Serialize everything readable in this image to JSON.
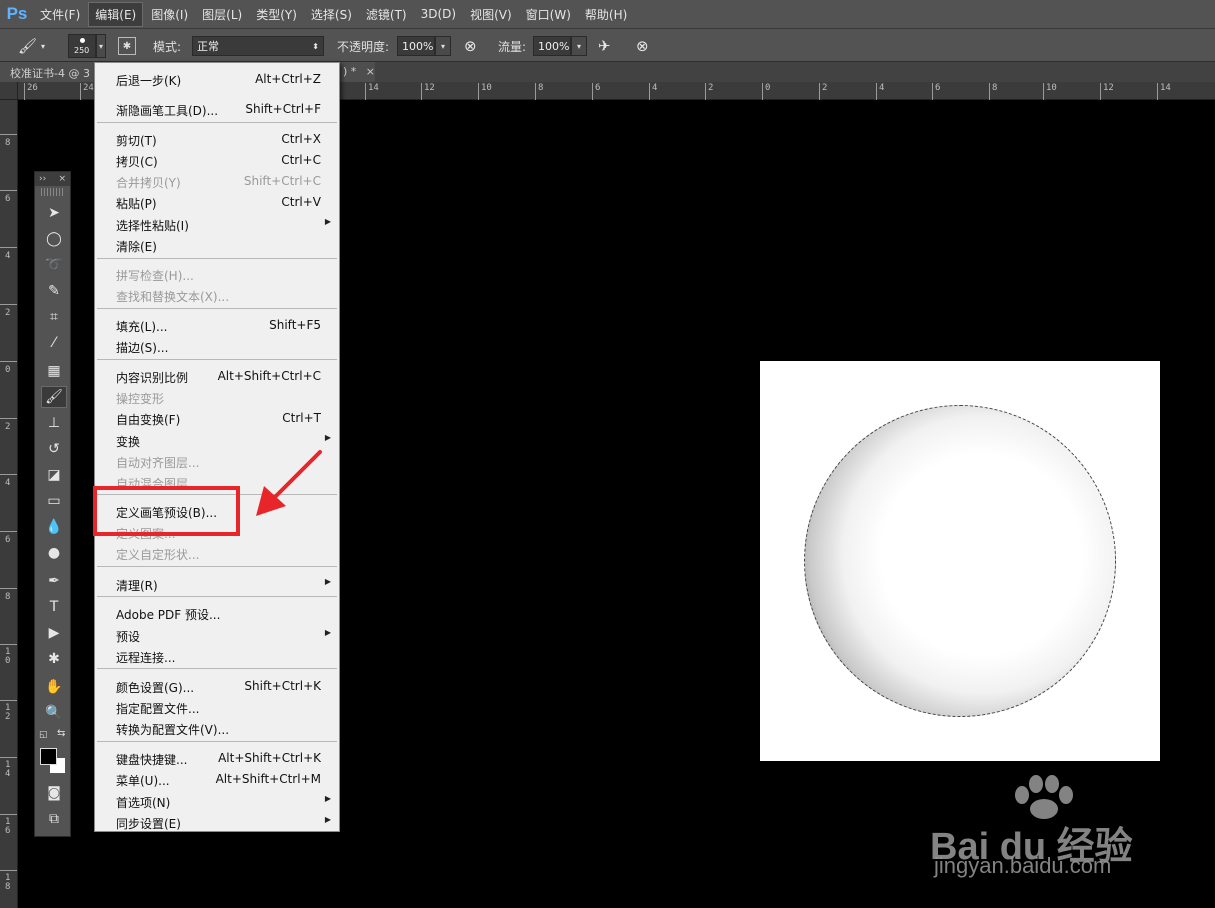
{
  "app": {
    "logo": "Ps",
    "menus": [
      "文件(F)",
      "编辑(E)",
      "图像(I)",
      "图层(L)",
      "类型(Y)",
      "选择(S)",
      "滤镜(T)",
      "3D(D)",
      "视图(V)",
      "窗口(W)",
      "帮助(H)"
    ],
    "active_menu": "编辑(E)"
  },
  "options_bar": {
    "brush_size": "250",
    "mode_label": "模式:",
    "mode_value": "正常",
    "opacity_label": "不透明度:",
    "opacity_value": "100%",
    "flow_label": "流量:",
    "flow_value": "100%"
  },
  "tabs": {
    "doc_tab_label": "校准证书-4 @ 3",
    "doc_tab_tail": ") *",
    "close_symbol": "×"
  },
  "ruler": {
    "top_ticks": [
      "26",
      "24",
      "14",
      "12",
      "10",
      "8",
      "6",
      "4",
      "2",
      "0",
      "2",
      "4",
      "6",
      "8",
      "10",
      "12",
      "14"
    ],
    "left_ticks": [
      "8",
      "6",
      "4",
      "2",
      "0",
      "2",
      "4",
      "6",
      "8",
      "1 0",
      "1 2",
      "1 4",
      "1 6",
      "1 8"
    ]
  },
  "toolbox": {
    "header_left": "››",
    "header_right": "×"
  },
  "edit_menu": {
    "items": [
      {
        "label": "后退一步(K)",
        "shortcut": "Alt+Ctrl+Z",
        "enabled": true
      },
      {
        "label": "渐隐画笔工具(D)...",
        "shortcut": "Shift+Ctrl+F",
        "enabled": true
      },
      {
        "label": "剪切(T)",
        "shortcut": "Ctrl+X",
        "enabled": true
      },
      {
        "label": "拷贝(C)",
        "shortcut": "Ctrl+C",
        "enabled": true
      },
      {
        "label": "合并拷贝(Y)",
        "shortcut": "Shift+Ctrl+C",
        "enabled": false
      },
      {
        "label": "粘贴(P)",
        "shortcut": "Ctrl+V",
        "enabled": true
      },
      {
        "label": "选择性粘贴(I)",
        "shortcut": "",
        "enabled": true,
        "submenu": true
      },
      {
        "label": "清除(E)",
        "shortcut": "",
        "enabled": true
      },
      {
        "label": "拼写检查(H)...",
        "shortcut": "",
        "enabled": false
      },
      {
        "label": "查找和替换文本(X)...",
        "shortcut": "",
        "enabled": false
      },
      {
        "label": "填充(L)...",
        "shortcut": "Shift+F5",
        "enabled": true
      },
      {
        "label": "描边(S)...",
        "shortcut": "",
        "enabled": true
      },
      {
        "label": "内容识别比例",
        "shortcut": "Alt+Shift+Ctrl+C",
        "enabled": true
      },
      {
        "label": "操控变形",
        "shortcut": "",
        "enabled": false
      },
      {
        "label": "自由变换(F)",
        "shortcut": "Ctrl+T",
        "enabled": true
      },
      {
        "label": "变换",
        "shortcut": "",
        "enabled": true,
        "submenu": true
      },
      {
        "label": "自动对齐图层...",
        "shortcut": "",
        "enabled": false
      },
      {
        "label": "自动混合图层...",
        "shortcut": "",
        "enabled": false
      },
      {
        "label": "定义画笔预设(B)...",
        "shortcut": "",
        "enabled": true
      },
      {
        "label": "定义图案...",
        "shortcut": "",
        "enabled": false
      },
      {
        "label": "定义自定形状...",
        "shortcut": "",
        "enabled": false
      },
      {
        "label": "清理(R)",
        "shortcut": "",
        "enabled": true,
        "submenu": true
      },
      {
        "label": "Adobe PDF 预设...",
        "shortcut": "",
        "enabled": true
      },
      {
        "label": "预设",
        "shortcut": "",
        "enabled": true,
        "submenu": true
      },
      {
        "label": "远程连接...",
        "shortcut": "",
        "enabled": true
      },
      {
        "label": "颜色设置(G)...",
        "shortcut": "Shift+Ctrl+K",
        "enabled": true
      },
      {
        "label": "指定配置文件...",
        "shortcut": "",
        "enabled": true
      },
      {
        "label": "转换为配置文件(V)...",
        "shortcut": "",
        "enabled": true
      },
      {
        "label": "键盘快捷键...",
        "shortcut": "Alt+Shift+Ctrl+K",
        "enabled": true
      },
      {
        "label": "菜单(U)...",
        "shortcut": "Alt+Shift+Ctrl+M",
        "enabled": true
      },
      {
        "label": "首选项(N)",
        "shortcut": "",
        "enabled": true,
        "submenu": true
      },
      {
        "label": "同步设置(E)",
        "shortcut": "",
        "enabled": true,
        "submenu": true
      }
    ]
  },
  "annotation": {
    "highlight_color": "#e8262a",
    "arrow_color": "#e8262a"
  },
  "watermark": {
    "logo_text": "Bai du 经验",
    "url": "jingyan.baidu.com"
  },
  "colors": {
    "ps_blue": "#5fb3ff",
    "chrome": "#535353",
    "menu_bg": "#f0f0f0"
  }
}
